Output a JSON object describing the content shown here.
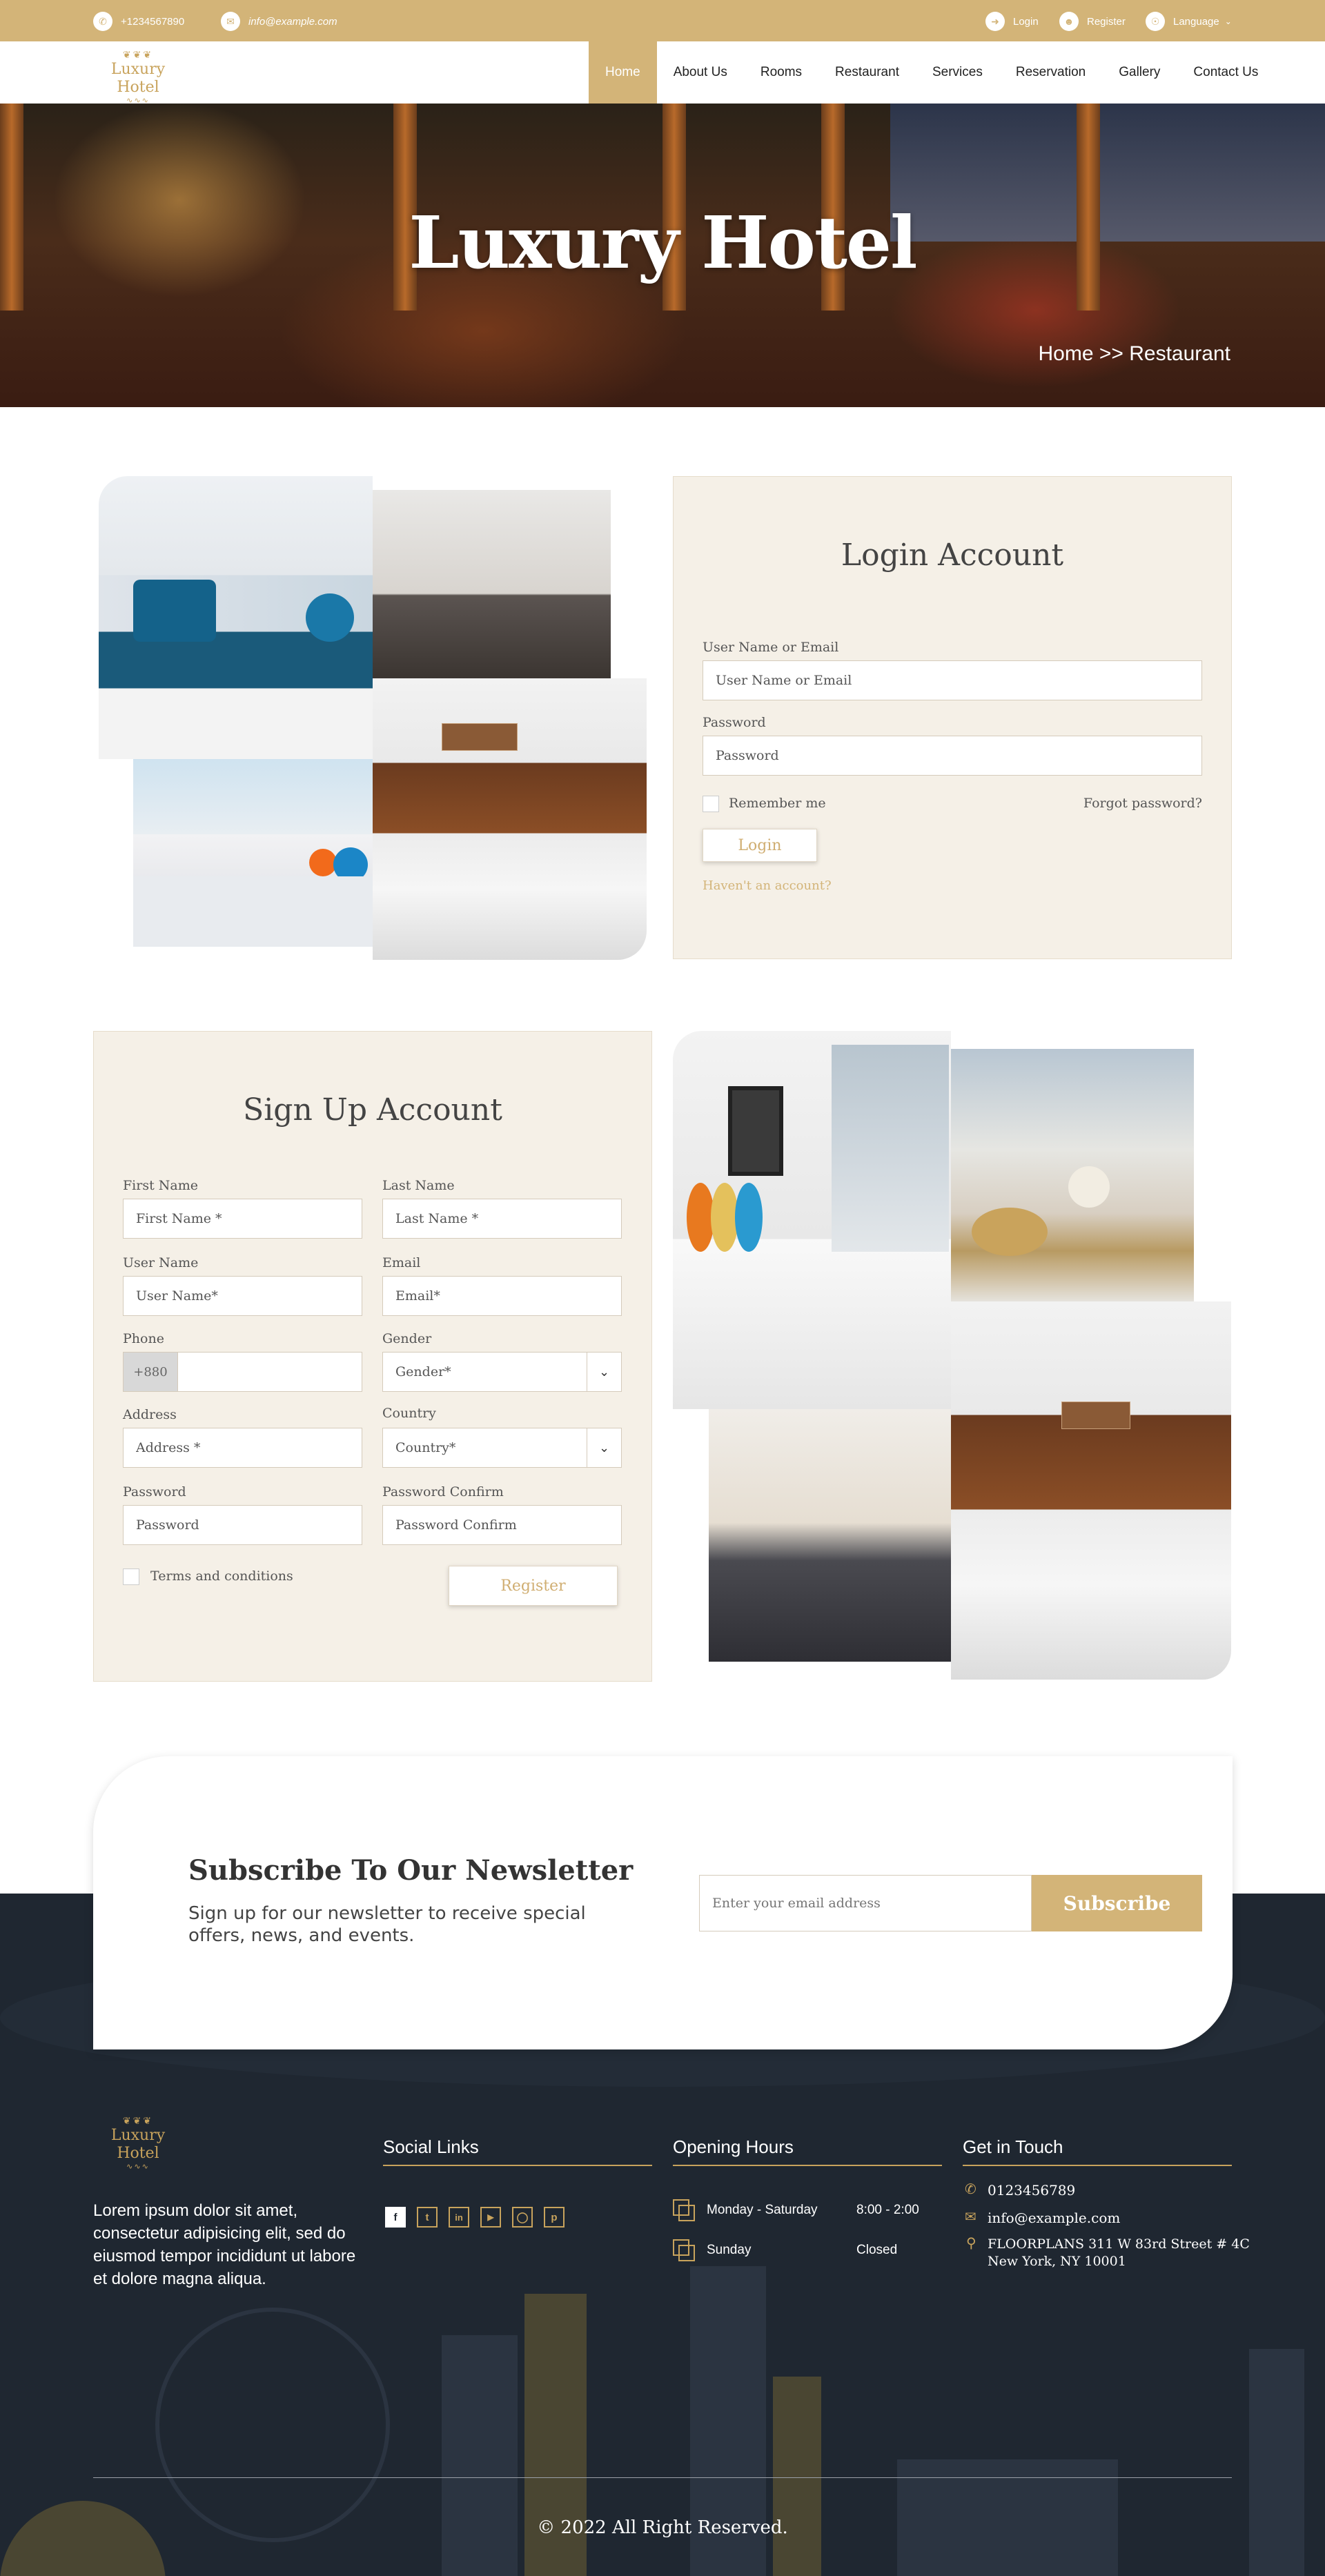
{
  "topbar": {
    "phone": "+1234567890",
    "email": "info@example.com",
    "login": "Login",
    "register": "Register",
    "language": "Language"
  },
  "logo": {
    "text": "Luxury Hotel"
  },
  "nav": [
    "Home",
    "About Us",
    "Rooms",
    "Restaurant",
    "Services",
    "Reservation",
    "Gallery",
    "Contact Us"
  ],
  "hero": {
    "title": "Luxury Hotel",
    "breadcrumb": "Home >> Restaurant"
  },
  "login": {
    "title": "Login Account",
    "username_label": "User Name or Email",
    "username_placeholder": "User Name or Email",
    "password_label": "Password",
    "password_placeholder": "Password",
    "remember": "Remember me",
    "forgot": "Forgot password?",
    "button": "Login",
    "no_account": "Haven't an account?"
  },
  "signup": {
    "title": "Sign Up Account",
    "first_name_label": "First Name",
    "first_name_placeholder": "First Name *",
    "last_name_label": "Last Name",
    "last_name_placeholder": "Last Name *",
    "username_label": "User Name",
    "username_placeholder": "User Name*",
    "email_label": "Email",
    "email_placeholder": "Email*",
    "phone_label": "Phone",
    "phone_prefix": "+880",
    "gender_label": "Gender",
    "gender_value": "Gender*",
    "address_label": "Address",
    "address_placeholder": "Address *",
    "country_label": "Country",
    "country_value": "Country*",
    "password_label": "Password",
    "password_placeholder": "Password",
    "password_confirm_label": "Password Confirm",
    "password_confirm_placeholder": "Password Confirm",
    "terms": "Terms and conditions",
    "button": "Register"
  },
  "newsletter": {
    "title": "Subscribe To Our Newsletter",
    "text": "Sign up for our newsletter to receive special offers, news, and events.",
    "input_placeholder": "Enter your email address",
    "button": "Subscribe"
  },
  "footer": {
    "about": "Lorem ipsum dolor sit amet, consectetur adipisicing elit, sed do eiusmod tempor incididunt ut labore et dolore magna aliqua.",
    "social_title": "Social Links",
    "hours_title": "Opening Hours",
    "hours": [
      {
        "day": "Monday  - Saturday",
        "time": "8:00 - 2:00"
      },
      {
        "day": "Sunday",
        "time": "Closed"
      }
    ],
    "contact_title": "Get in Touch",
    "phone": "0123456789",
    "email": "info@example.com",
    "address_line1": "FLOORPLANS 311 W 83rd Street # 4C",
    "address_line2": "New York, NY 10001",
    "copyright": "© 2022 All Right Reserved."
  },
  "colors": {
    "gold": "#d3b478",
    "dark": "#1f2731",
    "cream": "#f5f0e7"
  }
}
